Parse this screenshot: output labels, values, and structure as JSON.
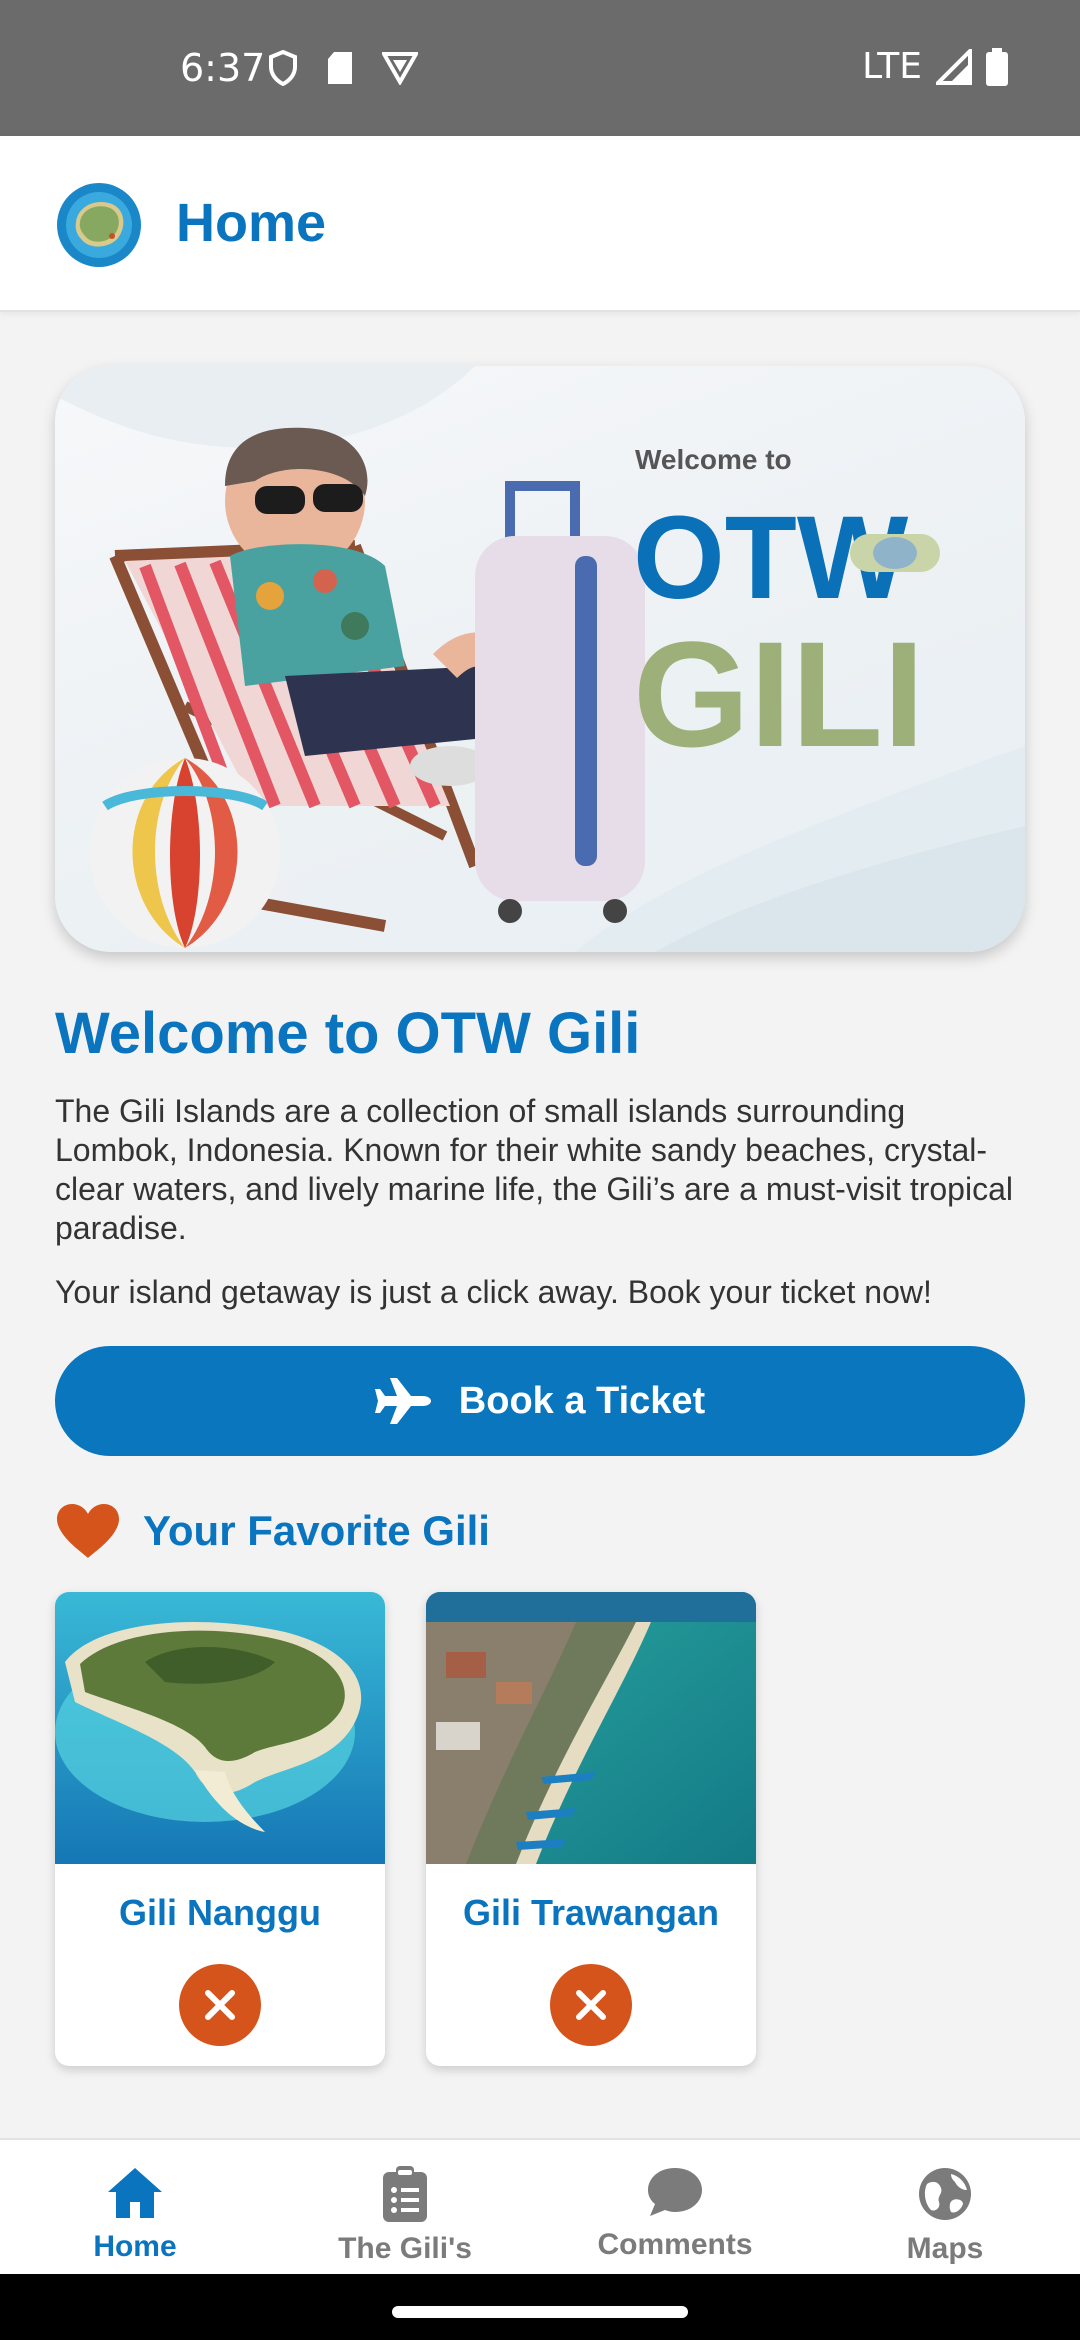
{
  "status_bar": {
    "time": "6:37",
    "network": "LTE"
  },
  "app_bar": {
    "title": "Home"
  },
  "hero": {
    "welcome_small": "Welcome to",
    "brand_line1": "OTW",
    "brand_line2": "GILI"
  },
  "main": {
    "heading": "Welcome to OTW Gili",
    "intro": "The Gili Islands are a collection of small islands surrounding Lombok, Indonesia. Known for their white sandy beaches, crystal-clear waters, and lively marine life, the Gili’s are a must-visit tropical paradise.",
    "cta_text": "Your island getaway is just a click away. Book your ticket now!",
    "book_button_label": "Book a Ticket"
  },
  "favorites": {
    "title": "Your Favorite Gili",
    "items": [
      {
        "name": "Gili Nanggu"
      },
      {
        "name": "Gili Trawangan"
      }
    ]
  },
  "bottom_nav": {
    "items": [
      {
        "label": "Home",
        "icon": "home-icon",
        "active": true
      },
      {
        "label": "The Gili's",
        "icon": "clipboard-list-icon",
        "active": false
      },
      {
        "label": "Comments",
        "icon": "chat-bubble-icon",
        "active": false
      },
      {
        "label": "Maps",
        "icon": "globe-icon",
        "active": false
      }
    ]
  },
  "colors": {
    "primary": "#0a74bf",
    "accent_orange": "#d5541c",
    "status_bar": "#6b6b6b",
    "background": "#f3f3f3"
  }
}
